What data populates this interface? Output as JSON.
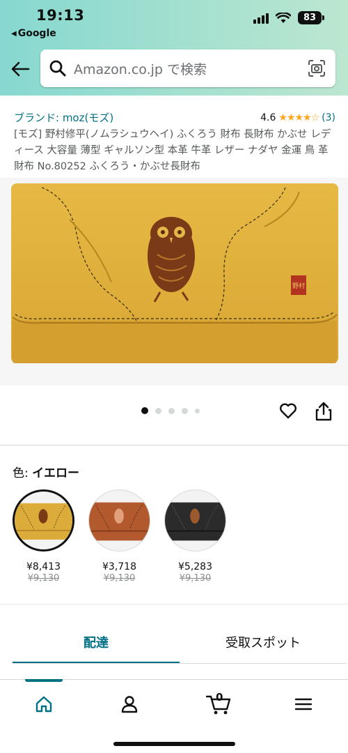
{
  "status_bar": {
    "time": "19:13",
    "back_app": "Google",
    "battery": "83"
  },
  "search": {
    "placeholder": "Amazon.co.jp で検索"
  },
  "product": {
    "brand": "ブランド: moz(モズ)",
    "rating": "4.6",
    "rating_count": "(3)",
    "title": "[モズ] 野村修平(ノムラシュウヘイ) ふくろう 財布 長財布 かぶせ レディース 大容量 薄型 ギャルソン型 本革 牛革 レザー ナダヤ 金運 鳥 革財布 No.80252 ふくろう・かぶせ長財布"
  },
  "image_pager": {
    "count": 5,
    "active_index": 0
  },
  "color": {
    "label": "色: ",
    "selected": "イエロー"
  },
  "variants": [
    {
      "name": "イエロー",
      "color": "#dcac3b",
      "price": "¥8,413",
      "old_price": "¥9,130",
      "selected": true
    },
    {
      "name": "ブラウン",
      "color": "#b25a2e",
      "price": "¥3,718",
      "old_price": "¥9,130",
      "selected": false
    },
    {
      "name": "ブラック",
      "color": "#2b2b2b",
      "price": "¥5,283",
      "old_price": "¥9,130",
      "selected": false
    }
  ],
  "tabs": [
    {
      "label": "配達",
      "active": true
    },
    {
      "label": "受取スポット",
      "active": false
    }
  ],
  "bottom_nav": {
    "cart_count": "0",
    "items": [
      "home-icon",
      "account-icon",
      "cart-icon",
      "menu-icon"
    ]
  },
  "colors": {
    "accent": "#007185",
    "star": "#ffa41c",
    "header_gradient_start": "#86d8d0",
    "header_gradient_end": "#bce7d0",
    "wallet": "#e3b53f"
  }
}
